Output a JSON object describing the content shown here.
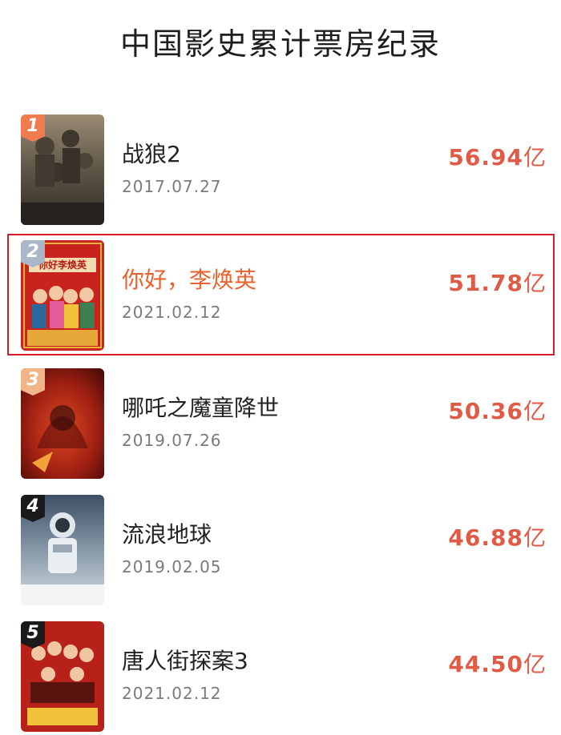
{
  "page_title": "中国影史累计票房纪录",
  "colors": {
    "gross": "#df5b46",
    "highlight_name": "#e8622f",
    "highlight_border": "#d21f2b",
    "rank_1": "#f07b4f",
    "rank_2": "#aab7c8",
    "rank_3": "#f0b68a",
    "rank_other": "#1a1a1a"
  },
  "films": [
    {
      "rank": "1",
      "name": "战狼2",
      "date": "2017.07.27",
      "gross_value": "56.94",
      "gross_unit": "亿"
    },
    {
      "rank": "2",
      "name": "你好，李焕英",
      "date": "2021.02.12",
      "gross_value": "51.78",
      "gross_unit": "亿",
      "poster_text": "你好李焕英"
    },
    {
      "rank": "3",
      "name": "哪吒之魔童降世",
      "date": "2019.07.26",
      "gross_value": "50.36",
      "gross_unit": "亿"
    },
    {
      "rank": "4",
      "name": "流浪地球",
      "date": "2019.02.05",
      "gross_value": "46.88",
      "gross_unit": "亿"
    },
    {
      "rank": "5",
      "name": "唐人街探案3",
      "date": "2021.02.12",
      "gross_value": "44.50",
      "gross_unit": "亿"
    }
  ]
}
